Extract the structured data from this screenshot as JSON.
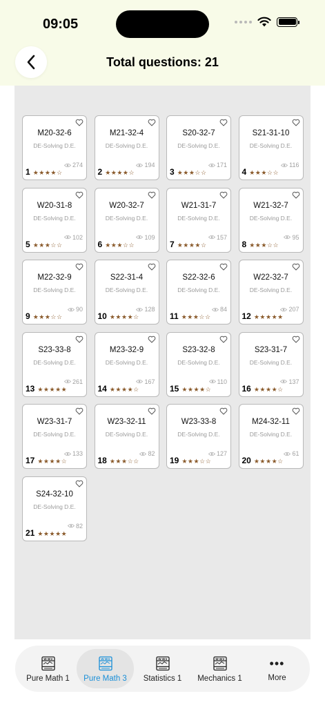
{
  "status": {
    "time": "09:05"
  },
  "header": {
    "title": "Total questions: 21",
    "back_icon": "chevron-left-icon"
  },
  "colors": {
    "header_bg": "#f8fbe8",
    "panel_bg": "#e9e9e9",
    "star": "#8a5a2b",
    "active_tab": "#1a8fd8"
  },
  "questions": [
    {
      "num": "1",
      "code": "M20-32-6",
      "topic": "DE-Solving D.E.",
      "views": "274",
      "stars": "★★★★☆"
    },
    {
      "num": "2",
      "code": "M21-32-4",
      "topic": "DE-Solving D.E.",
      "views": "194",
      "stars": "★★★★☆"
    },
    {
      "num": "3",
      "code": "S20-32-7",
      "topic": "DE-Solving D.E.",
      "views": "171",
      "stars": "★★★☆☆"
    },
    {
      "num": "4",
      "code": "S21-31-10",
      "topic": "DE-Solving D.E.",
      "views": "116",
      "stars": "★★★☆☆"
    },
    {
      "num": "5",
      "code": "W20-31-8",
      "topic": "DE-Solving D.E.",
      "views": "102",
      "stars": "★★★☆☆"
    },
    {
      "num": "6",
      "code": "W20-32-7",
      "topic": "DE-Solving D.E.",
      "views": "109",
      "stars": "★★★☆☆"
    },
    {
      "num": "7",
      "code": "W21-31-7",
      "topic": "DE-Solving D.E.",
      "views": "157",
      "stars": "★★★★☆"
    },
    {
      "num": "8",
      "code": "W21-32-7",
      "topic": "DE-Solving D.E.",
      "views": "95",
      "stars": "★★★☆☆"
    },
    {
      "num": "9",
      "code": "M22-32-9",
      "topic": "DE-Solving D.E.",
      "views": "90",
      "stars": "★★★☆☆"
    },
    {
      "num": "10",
      "code": "S22-31-4",
      "topic": "DE-Solving D.E.",
      "views": "128",
      "stars": "★★★★☆"
    },
    {
      "num": "11",
      "code": "S22-32-6",
      "topic": "DE-Solving D.E.",
      "views": "84",
      "stars": "★★★☆☆"
    },
    {
      "num": "12",
      "code": "W22-32-7",
      "topic": "DE-Solving D.E.",
      "views": "207",
      "stars": "★★★★★"
    },
    {
      "num": "13",
      "code": "S23-33-8",
      "topic": "DE-Solving D.E.",
      "views": "261",
      "stars": "★★★★★"
    },
    {
      "num": "14",
      "code": "M23-32-9",
      "topic": "DE-Solving D.E.",
      "views": "167",
      "stars": "★★★★☆"
    },
    {
      "num": "15",
      "code": "S23-32-8",
      "topic": "DE-Solving D.E.",
      "views": "110",
      "stars": "★★★★☆"
    },
    {
      "num": "16",
      "code": "S23-31-7",
      "topic": "DE-Solving D.E.",
      "views": "137",
      "stars": "★★★★☆"
    },
    {
      "num": "17",
      "code": "W23-31-7",
      "topic": "DE-Solving D.E.",
      "views": "133",
      "stars": "★★★★☆"
    },
    {
      "num": "18",
      "code": "W23-32-11",
      "topic": "DE-Solving D.E.",
      "views": "82",
      "stars": "★★★☆☆"
    },
    {
      "num": "19",
      "code": "W23-33-8",
      "topic": "DE-Solving D.E.",
      "views": "127",
      "stars": "★★★☆☆"
    },
    {
      "num": "20",
      "code": "M24-32-11",
      "topic": "DE-Solving D.E.",
      "views": "61",
      "stars": "★★★★☆"
    },
    {
      "num": "21",
      "code": "S24-32-10",
      "topic": "DE-Solving D.E.",
      "views": "82",
      "stars": "★★★★★"
    }
  ],
  "tabs": [
    {
      "label": "Pure Math 1",
      "icon": "book-icon",
      "active": false
    },
    {
      "label": "Pure Math 3",
      "icon": "book-icon",
      "active": true
    },
    {
      "label": "Statistics 1",
      "icon": "book-icon",
      "active": false
    },
    {
      "label": "Mechanics 1",
      "icon": "book-icon",
      "active": false
    },
    {
      "label": "More",
      "icon": "more-icon",
      "active": false
    }
  ]
}
